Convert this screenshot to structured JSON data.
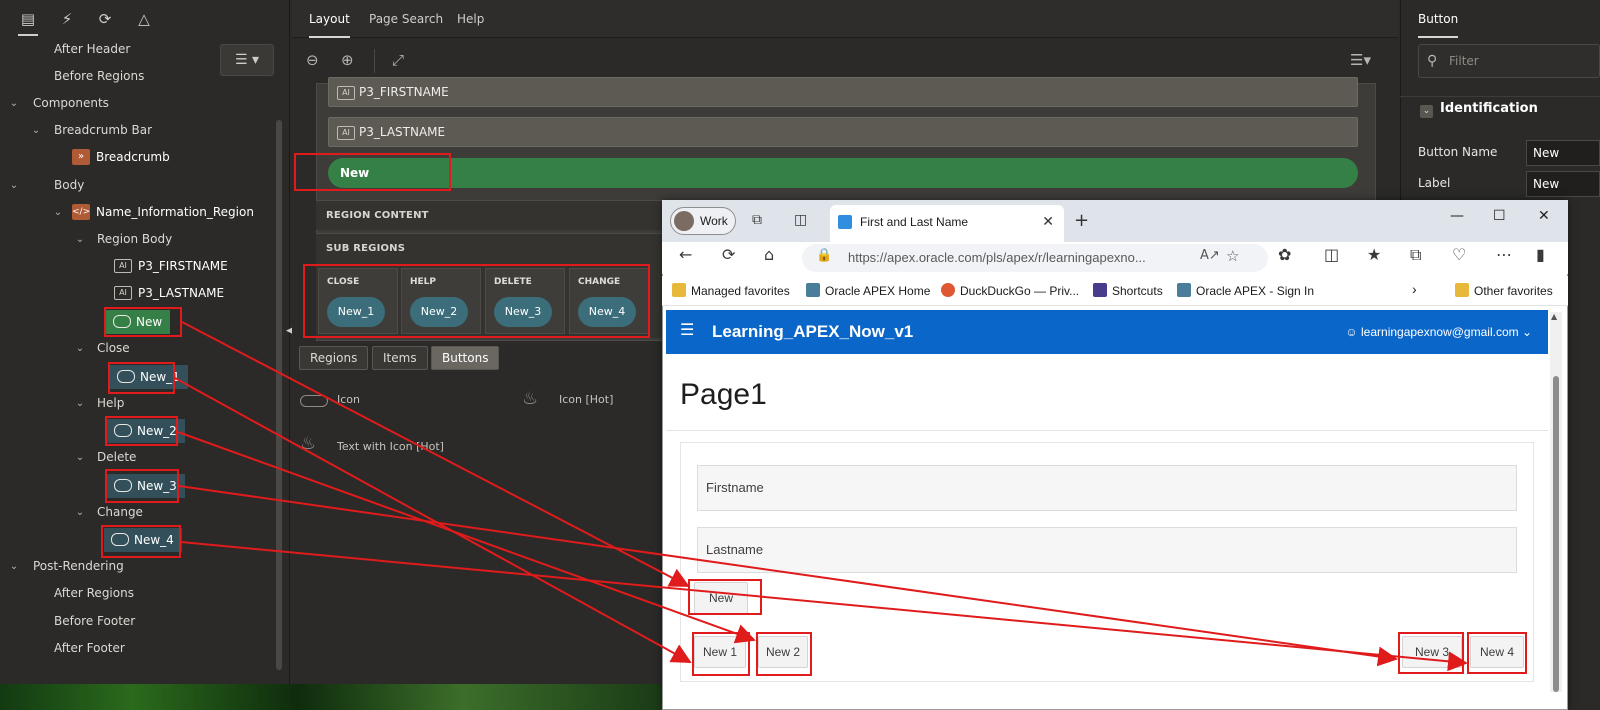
{
  "tree": {
    "toolbar_icons": [
      "rendering-tree-icon",
      "dynamic-actions-icon",
      "processing-icon",
      "shared-components-icon"
    ],
    "nodes": {
      "after_header": "After Header",
      "before_regions": "Before Regions",
      "components": "Components",
      "breadcrumb_bar": "Breadcrumb Bar",
      "breadcrumb": "Breadcrumb",
      "body": "Body",
      "name_region": "Name_Information_Region",
      "region_body": "Region Body",
      "p3_firstname": "P3_FIRSTNAME",
      "p3_lastname": "P3_LASTNAME",
      "btn_new": "New",
      "close": "Close",
      "btn_new1": "New_1",
      "help": "Help",
      "btn_new2": "New_2",
      "delete": "Delete",
      "btn_new3": "New_3",
      "change": "Change",
      "btn_new4": "New_4",
      "post_rendering": "Post-Rendering",
      "after_regions": "After Regions",
      "before_footer": "Before Footer",
      "after_footer": "After Footer"
    },
    "item_badge": "AI"
  },
  "center": {
    "tabs": [
      "Layout",
      "Page Search",
      "Help"
    ],
    "canvas": {
      "items": [
        "P3_FIRSTNAME",
        "P3_LASTNAME"
      ],
      "new_button": "New",
      "region_content": "REGION CONTENT",
      "sub_regions": "SUB REGIONS",
      "subregion_cols": [
        {
          "title": "CLOSE",
          "button": "New_1"
        },
        {
          "title": "HELP",
          "button": "New_2"
        },
        {
          "title": "DELETE",
          "button": "New_3"
        },
        {
          "title": "CHANGE",
          "button": "New_4"
        }
      ]
    },
    "gallery_tabs": [
      "Regions",
      "Items",
      "Buttons"
    ],
    "gallery_items": [
      "Icon",
      "Icon [Hot]",
      "Text with Icon [Hot]"
    ]
  },
  "props": {
    "tab": "Button",
    "filter_placeholder": "Filter",
    "section": "Identification",
    "rows": [
      {
        "label": "Button Name",
        "value": "New"
      },
      {
        "label": "Label",
        "value": "New"
      }
    ]
  },
  "browser": {
    "profile": "Work",
    "tab_title": "First and Last Name",
    "url": "https://apex.oracle.com/pls/apex/r/learningapexno...",
    "bookmarks": [
      "Managed favorites",
      "Oracle APEX Home",
      "DuckDuckGo — Priv...",
      "Shortcuts",
      "Oracle APEX - Sign In",
      "Other favorites"
    ],
    "app": {
      "title": "Learning_APEX_Now_v1",
      "user": "learningapexnow@gmail.com",
      "page_title": "Page1",
      "fields": [
        "Firstname",
        "Lastname"
      ],
      "buttons": [
        "New",
        "New 1",
        "New 2",
        "New 3",
        "New 4"
      ]
    }
  },
  "colors": {
    "highlight": "#e01b1b",
    "apex_header": "#0b66c9",
    "green_button": "#348046",
    "teal_button": "#3b6d7a"
  }
}
